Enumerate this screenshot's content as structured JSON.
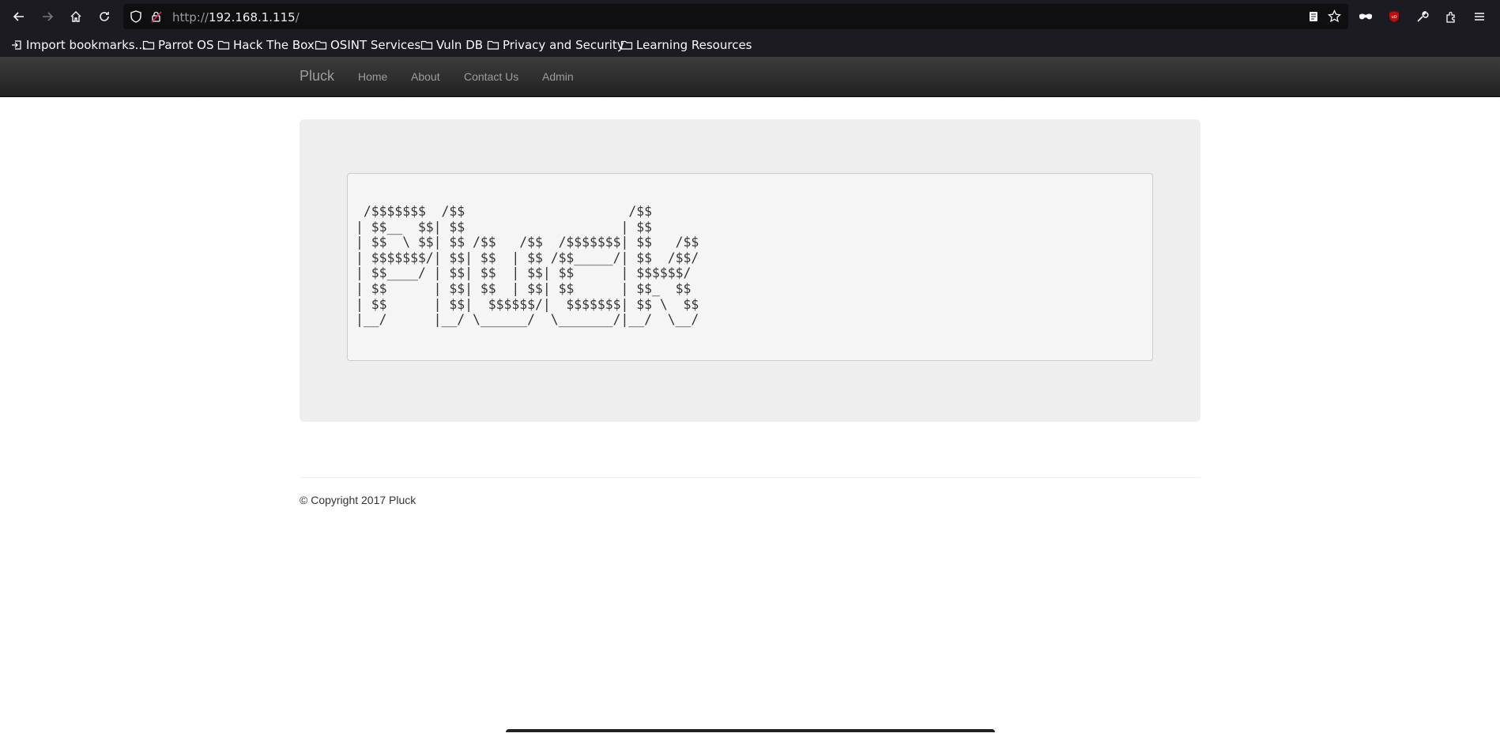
{
  "browser": {
    "url_scheme": "http://",
    "url_host": "192.168.1.115",
    "url_path": "/",
    "bookmarks": [
      {
        "label": "Import bookmarks..."
      },
      {
        "label": "Parrot OS"
      },
      {
        "label": "Hack The Box"
      },
      {
        "label": "OSINT Services"
      },
      {
        "label": "Vuln DB"
      },
      {
        "label": "Privacy and Security"
      },
      {
        "label": "Learning Resources"
      }
    ]
  },
  "site": {
    "brand": "Pluck",
    "nav": [
      "Home",
      "About",
      "Contact Us",
      "Admin"
    ],
    "ascii_banner": " /$$$$$$$  /$$                     /$$      \n| $$__  $$| $$                    | $$      \n| $$  \\ $$| $$ /$$   /$$  /$$$$$$$| $$   /$$\n| $$$$$$$/| $$| $$  | $$ /$$_____/| $$  /$$/\n| $$____/ | $$| $$  | $$| $$      | $$$$$$/ \n| $$      | $$| $$  | $$| $$      | $$_  $$ \n| $$      | $$|  $$$$$$/|  $$$$$$$| $$ \\  $$\n|__/      |__/ \\______/  \\_______/|__/  \\__/",
    "footer": "© Copyright 2017 Pluck"
  },
  "colors": {
    "navbar": "#222222",
    "jumbotron": "#eeeeee",
    "chrome": "#1c1b22"
  }
}
